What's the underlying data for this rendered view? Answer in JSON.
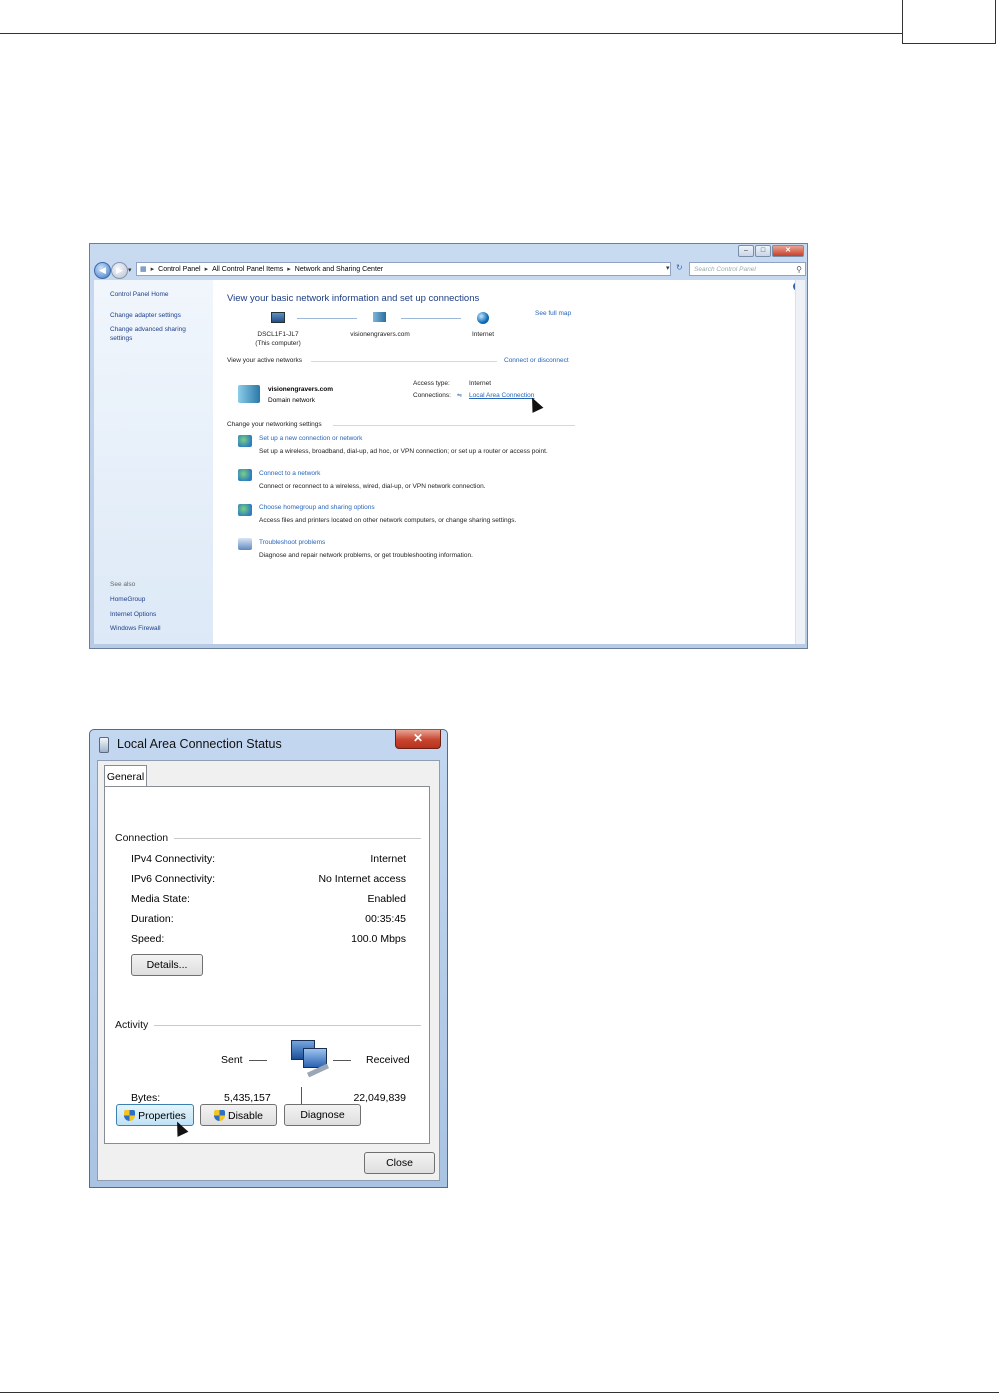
{
  "network_window": {
    "address_bar": [
      "Control Panel",
      "All Control Panel Items",
      "Network and Sharing Center"
    ],
    "search_placeholder": "Search Control Panel",
    "left_pane": {
      "home": "Control Panel Home",
      "links": [
        "Change adapter settings",
        "Change advanced sharing settings"
      ],
      "see_also_header": "See also",
      "see_also": [
        "HomeGroup",
        "Internet Options",
        "Windows Firewall"
      ]
    },
    "title": "View your basic network information and set up connections",
    "see_full_map": "See full map",
    "nodes": {
      "computer_name": "DSCL1F1-JL7",
      "computer_note": "(This computer)",
      "domain": "visionengravers.com",
      "internet": "Internet"
    },
    "active_networks_header": "View your active networks",
    "connect_or_disconnect": "Connect or disconnect",
    "network": {
      "name": "visionengravers.com",
      "type": "Domain network",
      "access_type_label": "Access type:",
      "access_type_value": "Internet",
      "connections_label": "Connections:",
      "connections_value": "Local Area Connection"
    },
    "change_settings_header": "Change your networking settings",
    "tasks": [
      {
        "title": "Set up a new connection or network",
        "desc": "Set up a wireless, broadband, dial-up, ad hoc, or VPN connection; or set up a router or access point."
      },
      {
        "title": "Connect to a network",
        "desc": "Connect or reconnect to a wireless, wired, dial-up, or VPN network connection."
      },
      {
        "title": "Choose homegroup and sharing options",
        "desc": "Access files and printers located on other network computers, or change sharing settings."
      },
      {
        "title": "Troubleshoot problems",
        "desc": "Diagnose and repair network problems, or get troubleshooting information."
      }
    ]
  },
  "status_dialog": {
    "title": "Local Area Connection Status",
    "tab": "General",
    "connection_header": "Connection",
    "rows": [
      {
        "label": "IPv4 Connectivity:",
        "value": "Internet"
      },
      {
        "label": "IPv6 Connectivity:",
        "value": "No Internet access"
      },
      {
        "label": "Media State:",
        "value": "Enabled"
      },
      {
        "label": "Duration:",
        "value": "00:35:45"
      },
      {
        "label": "Speed:",
        "value": "100.0 Mbps"
      }
    ],
    "details_button": "Details...",
    "activity_header": "Activity",
    "sent_label": "Sent",
    "received_label": "Received",
    "bytes_label": "Bytes:",
    "bytes_sent": "5,435,157",
    "bytes_received": "22,049,839",
    "properties_button": "Properties",
    "disable_button": "Disable",
    "diagnose_button": "Diagnose",
    "close_button": "Close"
  }
}
